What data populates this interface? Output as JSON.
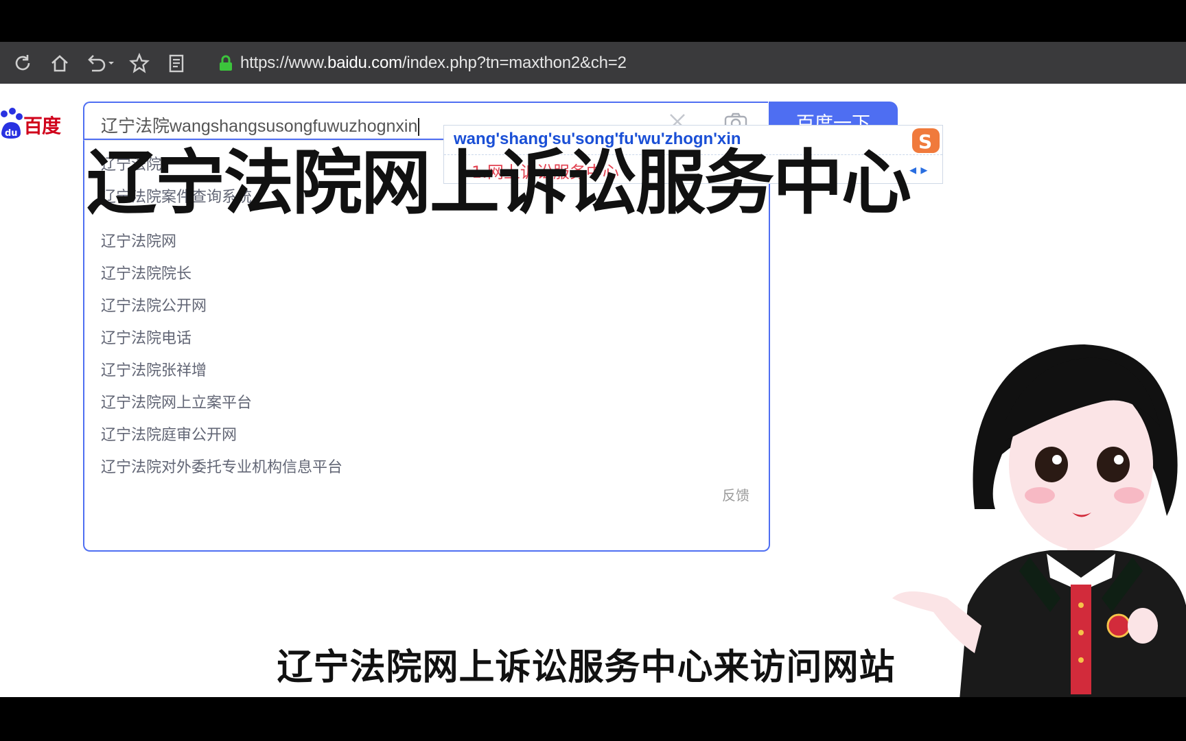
{
  "browser": {
    "toolbar_icons": [
      "refresh-icon",
      "home-icon",
      "undo-icon",
      "star-icon",
      "reader-icon",
      "lock-icon"
    ],
    "url_prefix": "https://www.",
    "url_domain": "baidu.com",
    "url_suffix": "/index.php?tn=maxthon2&ch=2"
  },
  "baidu": {
    "logo_text": "百度",
    "search_value": "辽宁法院wangshangsusongfuwuzhognxin",
    "search_button": "百度一下",
    "suggestions": [
      "辽宁法院",
      "辽宁法院案件查询系统",
      "辽宁法院网",
      "辽宁法院院长",
      "辽宁法院公开网",
      "辽宁法院电话",
      "辽宁法院张祥增",
      "辽宁法院网上立案平台",
      "辽宁法院庭审公开网",
      "辽宁法院对外委托专业机构信息平台"
    ],
    "feedback": "反馈"
  },
  "ime": {
    "pinyin": "wang'shang'su'song'fu'wu'zhogn'xin",
    "candidate": "1.网上诉讼服务中心"
  },
  "video": {
    "title_overlay": "辽宁法院网上诉讼服务中心",
    "subtitle": "辽宁法院网上诉讼服务中心来访问网站"
  },
  "colors": {
    "baidu_blue": "#4e6ef2",
    "baidu_red": "#d0021b",
    "toolbar_bg": "#3a3a3c"
  }
}
